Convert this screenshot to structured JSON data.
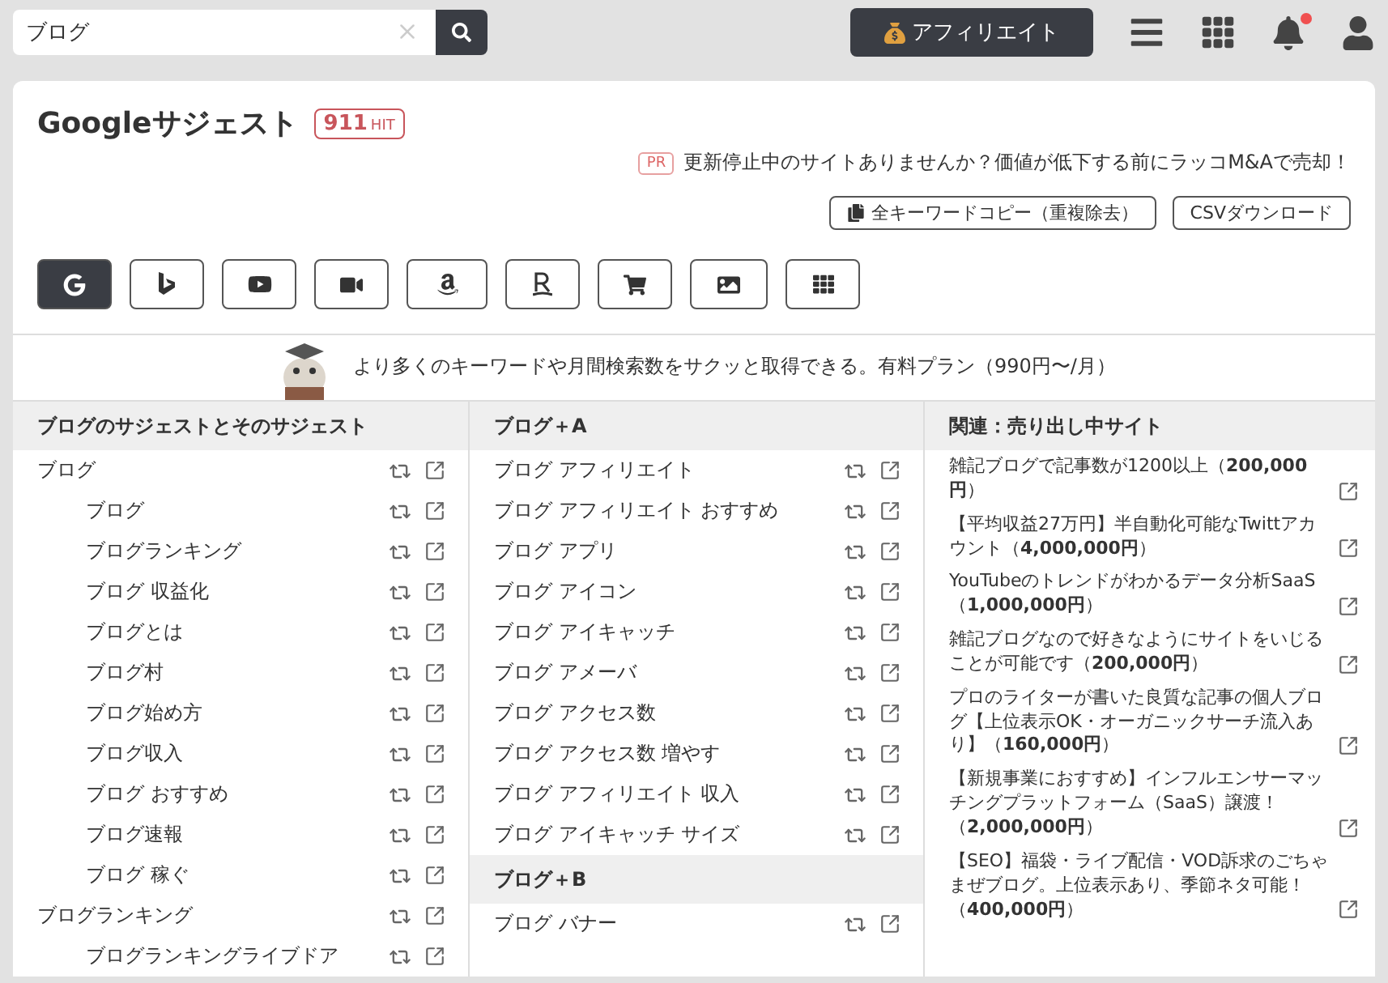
{
  "search": {
    "value": "ブログ"
  },
  "top_bar": {
    "affiliate_label": "アフィリエイト",
    "notification_unread": true
  },
  "header": {
    "title": "Googleサジェスト",
    "hit_count": "911",
    "hit_unit": "HIT"
  },
  "pr": {
    "badge": "PR",
    "text": "更新停止中のサイトありませんか？価値が低下する前にラッコM&Aで売却！"
  },
  "actions": [
    {
      "kind": "copy",
      "label": "全キーワードコピー（重複除去）"
    },
    {
      "kind": "plain",
      "label": "CSVダウンロード"
    }
  ],
  "engines": [
    {
      "kind": "google",
      "selected": true
    },
    {
      "kind": "bing",
      "selected": false
    },
    {
      "kind": "youtube",
      "selected": false
    },
    {
      "kind": "video",
      "selected": false
    },
    {
      "kind": "amazon",
      "selected": false
    },
    {
      "kind": "rakuten",
      "selected": false
    },
    {
      "kind": "cart",
      "selected": false
    },
    {
      "kind": "image",
      "selected": false
    },
    {
      "kind": "grid",
      "selected": false
    }
  ],
  "banner": {
    "text": "より多くのキーワードや月間検索数をサクッと取得できる。有料プラン（990円〜/月）"
  },
  "suggest_column": {
    "heading": "ブログのサジェストとそのサジェスト",
    "items": [
      {
        "label": "ブログ",
        "children": [
          {
            "label": "ブログ"
          },
          {
            "label": "ブログランキング"
          },
          {
            "label": "ブログ 収益化"
          },
          {
            "label": "ブログとは"
          },
          {
            "label": "ブログ村"
          },
          {
            "label": "ブログ始め方"
          },
          {
            "label": "ブログ収入"
          },
          {
            "label": "ブログ おすすめ"
          },
          {
            "label": "ブログ速報"
          },
          {
            "label": "ブログ 稼ぐ"
          }
        ]
      },
      {
        "label": "ブログランキング",
        "children": [
          {
            "label": "ブログランキングライブドア"
          }
        ]
      }
    ]
  },
  "letter_column": {
    "sections": [
      {
        "heading": "ブログ＋A",
        "items": [
          "ブログ アフィリエイト",
          "ブログ アフィリエイト おすすめ",
          "ブログ アプリ",
          "ブログ アイコン",
          "ブログ アイキャッチ",
          "ブログ アメーバ",
          "ブログ アクセス数",
          "ブログ アクセス数 増やす",
          "ブログ アフィリエイト 収入",
          "ブログ アイキャッチ サイズ"
        ]
      },
      {
        "heading": "ブログ＋B",
        "items": [
          "ブログ バナー"
        ]
      }
    ]
  },
  "sites_column": {
    "heading": "関連：売り出し中サイト",
    "items": [
      "雑記ブログで記事数が1200以上（**200,000円**）",
      "【平均収益27万円】半自動化可能なTwittアカウント（**4,000,000円**）",
      "YouTubeのトレンドがわかるデータ分析SaaS（**1,000,000円**）",
      "雑記ブログなので好きなようにサイトをいじることが可能です（**200,000円**）",
      "プロのライターが書いた良質な記事の個人ブログ【上位表示OK・オーガニックサーチ流入あり】（**160,000円**）",
      "【新規事業におすすめ】インフルエンサーマッチングプラットフォーム（SaaS）譲渡！（**2,000,000円**）",
      "【SEO】福袋・ライブ配信・VOD訴求のごちゃまぜブログ。上位表示あり、季節ネタ可能！（**400,000円**）"
    ]
  }
}
